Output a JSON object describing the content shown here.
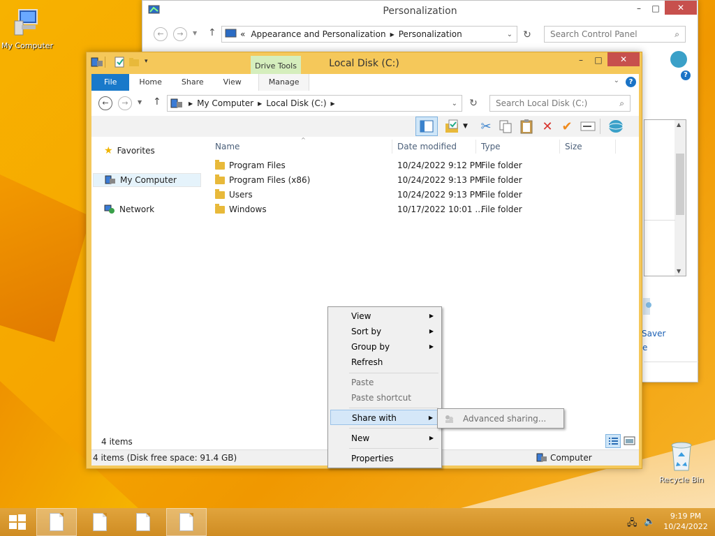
{
  "desktop": {
    "my_computer_label": "My Computer",
    "recycle_bin_label": "Recycle Bin"
  },
  "personalization": {
    "title": "Personalization",
    "breadcrumb_overflow": "«",
    "breadcrumb": [
      "Appearance and Personalization",
      "Personalization"
    ],
    "search_placeholder": "Search Control Panel",
    "partial_text_1": "Saver",
    "partial_text_2": "e"
  },
  "explorer": {
    "title": "Local Disk (C:)",
    "context_tab_group": "Drive Tools",
    "tabs": [
      "File",
      "Home",
      "Share",
      "View",
      "Manage"
    ],
    "breadcrumb": [
      "My Computer",
      "Local Disk (C:)"
    ],
    "search_placeholder": "Search Local Disk (C:)",
    "nav": [
      "Favorites",
      "My Computer",
      "Network"
    ],
    "columns": [
      "Name",
      "Date modified",
      "Type",
      "Size"
    ],
    "files": [
      {
        "name": "Program Files",
        "date": "10/24/2022 9:12 PM",
        "type": "File folder",
        "size": ""
      },
      {
        "name": "Program Files (x86)",
        "date": "10/24/2022 9:13 PM",
        "type": "File folder",
        "size": ""
      },
      {
        "name": "Users",
        "date": "10/24/2022 9:13 PM",
        "type": "File folder",
        "size": ""
      },
      {
        "name": "Windows",
        "date": "10/17/2022 10:01 ...",
        "type": "File folder",
        "size": ""
      }
    ],
    "item_count": "4 items",
    "status_text": "4 items (Disk free space: 91.4 GB)",
    "status_location": "Computer"
  },
  "context_menu": {
    "items": [
      "View",
      "Sort by",
      "Group by",
      "Refresh",
      "Paste",
      "Paste shortcut",
      "Share with",
      "New",
      "Properties"
    ],
    "submenu_item": "Advanced sharing..."
  },
  "taskbar": {
    "time": "9:19 PM",
    "date": "10/24/2022"
  },
  "colors": {
    "desktop_bg": "#f7a800",
    "file_tab": "#1979ca",
    "close_button": "#c7504d",
    "drive_tools_bg": "#d5eebd",
    "menu_highlight": "#d5e7f8"
  }
}
